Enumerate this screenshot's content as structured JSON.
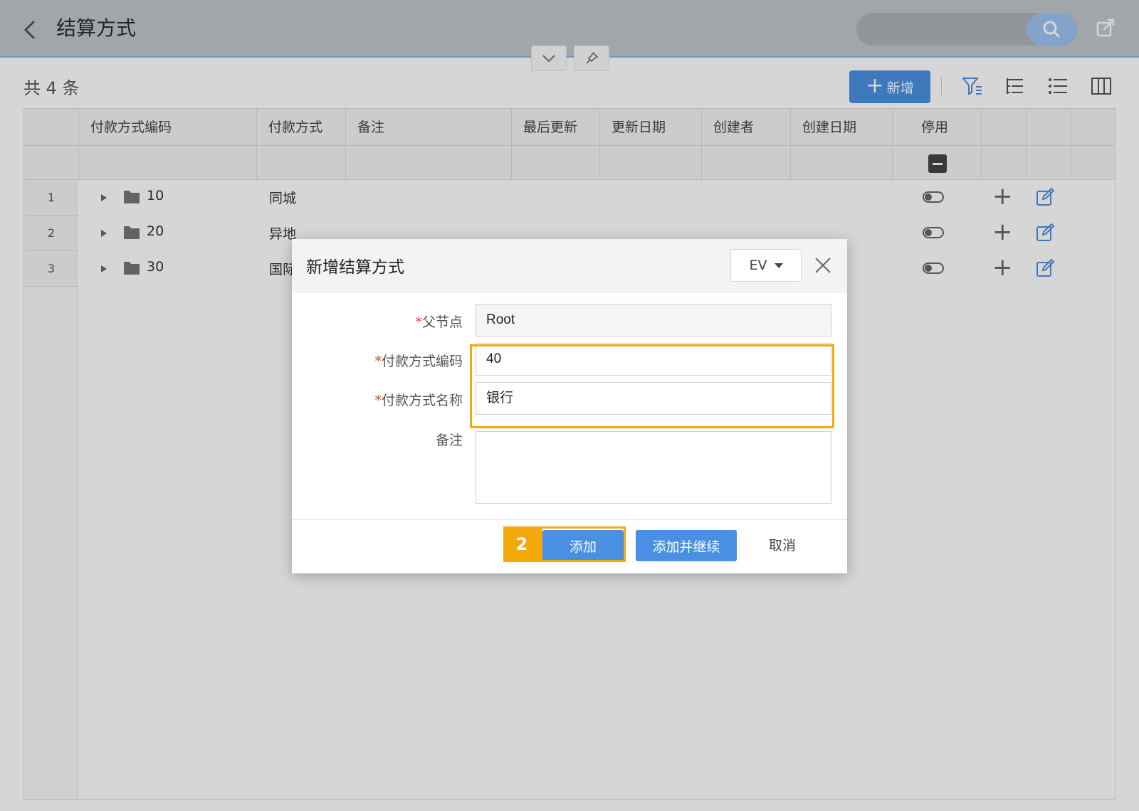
{
  "header": {
    "title": "结算方式",
    "back_icon": "chevron-left-icon",
    "search_icon": "search-icon",
    "share_icon": "share-icon"
  },
  "toolbar": {
    "record_count": "共 4 条",
    "add_label": "新增",
    "icons": [
      "filter-icon",
      "tree-list-icon",
      "list-icon",
      "columns-icon"
    ]
  },
  "grid": {
    "columns": [
      "付款方式编码",
      "付款方式",
      "备注",
      "最后更新",
      "更新日期",
      "创建者",
      "创建日期",
      "停用"
    ],
    "rows": [
      {
        "index": "1",
        "code": "10",
        "name": "同城"
      },
      {
        "index": "2",
        "code": "20",
        "name": "异地"
      },
      {
        "index": "3",
        "code": "30",
        "name": "国际"
      }
    ]
  },
  "dialog": {
    "title": "新增结算方式",
    "lang": "EV",
    "fields": {
      "parent": {
        "label": "父节点",
        "value": "Root"
      },
      "code": {
        "label": "付款方式编码",
        "value": "40"
      },
      "name": {
        "label": "付款方式名称",
        "value": "银行"
      },
      "remark": {
        "label": "备注",
        "value": ""
      }
    },
    "required_mark": "*",
    "step": "2",
    "buttons": {
      "add": "添加",
      "add_continue": "添加并继续",
      "cancel": "取消"
    }
  },
  "colors": {
    "primary": "#4a90e2",
    "highlight": "#f5a80c",
    "required": "#e0461d"
  }
}
